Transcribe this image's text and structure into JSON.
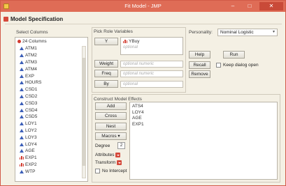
{
  "window": {
    "title": "Fit Model - JMP"
  },
  "window_controls": {
    "min": "–",
    "max": "□",
    "close": "✕"
  },
  "section": {
    "title": "Model Specification"
  },
  "select_columns": {
    "label": "Select Columns",
    "count": "24 Columns",
    "items": [
      {
        "name": "ATM1",
        "type": "continuous"
      },
      {
        "name": "ATM2",
        "type": "continuous"
      },
      {
        "name": "ATM3",
        "type": "continuous"
      },
      {
        "name": "ATM4",
        "type": "continuous"
      },
      {
        "name": "EXP",
        "type": "continuous"
      },
      {
        "name": "HOURS",
        "type": "continuous"
      },
      {
        "name": "CSD1",
        "type": "continuous"
      },
      {
        "name": "CSD2",
        "type": "continuous"
      },
      {
        "name": "CSD3",
        "type": "continuous"
      },
      {
        "name": "CSD4",
        "type": "continuous"
      },
      {
        "name": "CSD5",
        "type": "continuous"
      },
      {
        "name": "LOY1",
        "type": "continuous"
      },
      {
        "name": "LOY2",
        "type": "continuous"
      },
      {
        "name": "LOY3",
        "type": "continuous"
      },
      {
        "name": "LOY4",
        "type": "continuous"
      },
      {
        "name": "AGE",
        "type": "continuous"
      },
      {
        "name": "EXP1",
        "type": "nominal"
      },
      {
        "name": "EXP2",
        "type": "nominal"
      },
      {
        "name": "WTP",
        "type": "continuous"
      }
    ]
  },
  "pick_role": {
    "label": "Pick Role Variables",
    "y_button": "Y",
    "y_variable": "YBuy",
    "y_optional": "optional",
    "weight_button": "Weight",
    "weight_placeholder": "optional numeric",
    "freq_button": "Freq",
    "freq_placeholder": "optional numeric",
    "by_button": "By",
    "by_placeholder": "optional"
  },
  "personality": {
    "label": "Personality:",
    "value": "Nominal Logistic"
  },
  "actions": {
    "help": "Help",
    "run": "Run",
    "recall": "Recall",
    "remove": "Remove",
    "keep_open": "Keep dialog open"
  },
  "construct": {
    "label": "Construct Model Effects",
    "add": "Add",
    "cross": "Cross",
    "nest": "Nest",
    "macros": "Macros ▾",
    "degree_label": "Degree",
    "degree_value": "2",
    "attributes": "Attributes",
    "transform": "Transform",
    "no_intercept": "No Intercept",
    "effects": [
      "ATS4",
      "LOY4",
      "AGE",
      "EXP1"
    ]
  },
  "colors": {
    "title_bar": "#df6c56",
    "background": "#f4f0e4",
    "continuous_icon": "#3c5fb8",
    "nominal_icon": "#d23b2f"
  }
}
